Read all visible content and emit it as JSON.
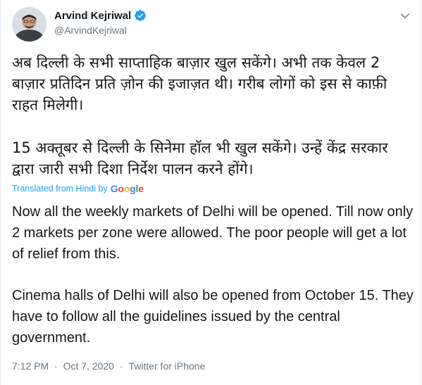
{
  "author": {
    "name": "Arvind Kejriwal",
    "handle": "@ArvindKejriwal",
    "verified": true
  },
  "icons": {
    "avatar": "avatar",
    "verified": "verified-badge-icon",
    "menu": "chevron-down-icon"
  },
  "colors": {
    "link_blue": "#1da1f2",
    "secondary_text": "#657786",
    "verified_blue": "#1da1f2"
  },
  "tweet": {
    "hindi_paragraph_1": "अब दिल्ली के सभी साप्ताहिक बाज़ार खुल सकेंगे। अभी तक केवल 2 बाज़ार प्रतिदिन प्रति ज़ोन की इजाज़त थी। गरीब लोगों को इस से काफ़ी राहत मिलेगी।",
    "hindi_paragraph_2": "15 अक्तूबर से दिल्ली के सिनेमा हॉल भी खुल सकेंगे। उन्हें केंद्र सरकार द्वारा जारी सभी दिशा निर्देश पालन करने होंगे।",
    "translated_label": "Translated from Hindi by",
    "translator": "Google",
    "english_paragraph_1": "Now all the weekly markets of Delhi will be opened. Till now only 2 markets per zone were allowed. The poor people will get a lot of relief from this.",
    "english_paragraph_2": " Cinema halls of Delhi will also be opened from October 15. They have to follow all the guidelines issued by the central government."
  },
  "meta": {
    "time": "7:12 PM",
    "date": "Oct 7, 2020",
    "separator": "·",
    "source": "Twitter for iPhone"
  }
}
